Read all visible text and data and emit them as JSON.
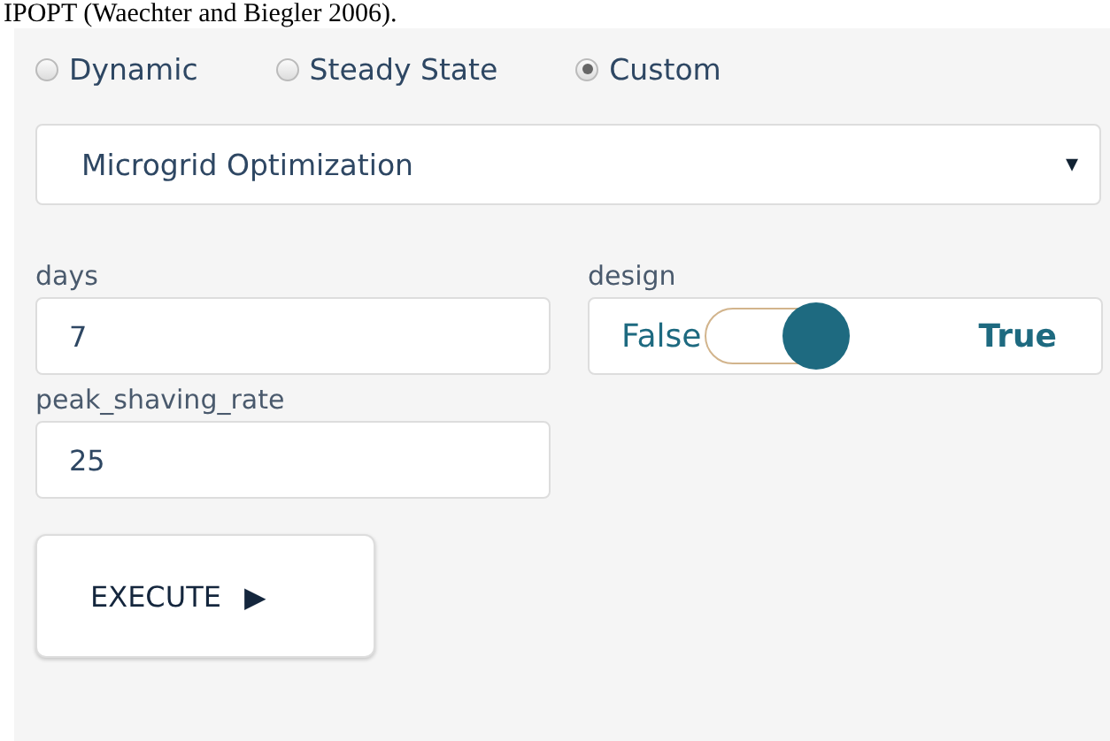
{
  "caption": "IPOPT (Waechter and Biegler 2006).",
  "modes": [
    {
      "label": "Dynamic",
      "selected": false
    },
    {
      "label": "Steady State",
      "selected": false
    },
    {
      "label": "Custom",
      "selected": true
    }
  ],
  "model_select": {
    "value": "Microgrid Optimization",
    "caret": "▾"
  },
  "fields": [
    {
      "kind": "text",
      "label": "days",
      "value": "7"
    },
    {
      "kind": "toggle",
      "label": "design",
      "false_label": "False",
      "true_label": "True",
      "on": true
    },
    {
      "kind": "text",
      "label": "peak_shaving_rate",
      "value": "25"
    }
  ],
  "execute_button": {
    "label": "EXECUTE",
    "icon": "▶"
  }
}
